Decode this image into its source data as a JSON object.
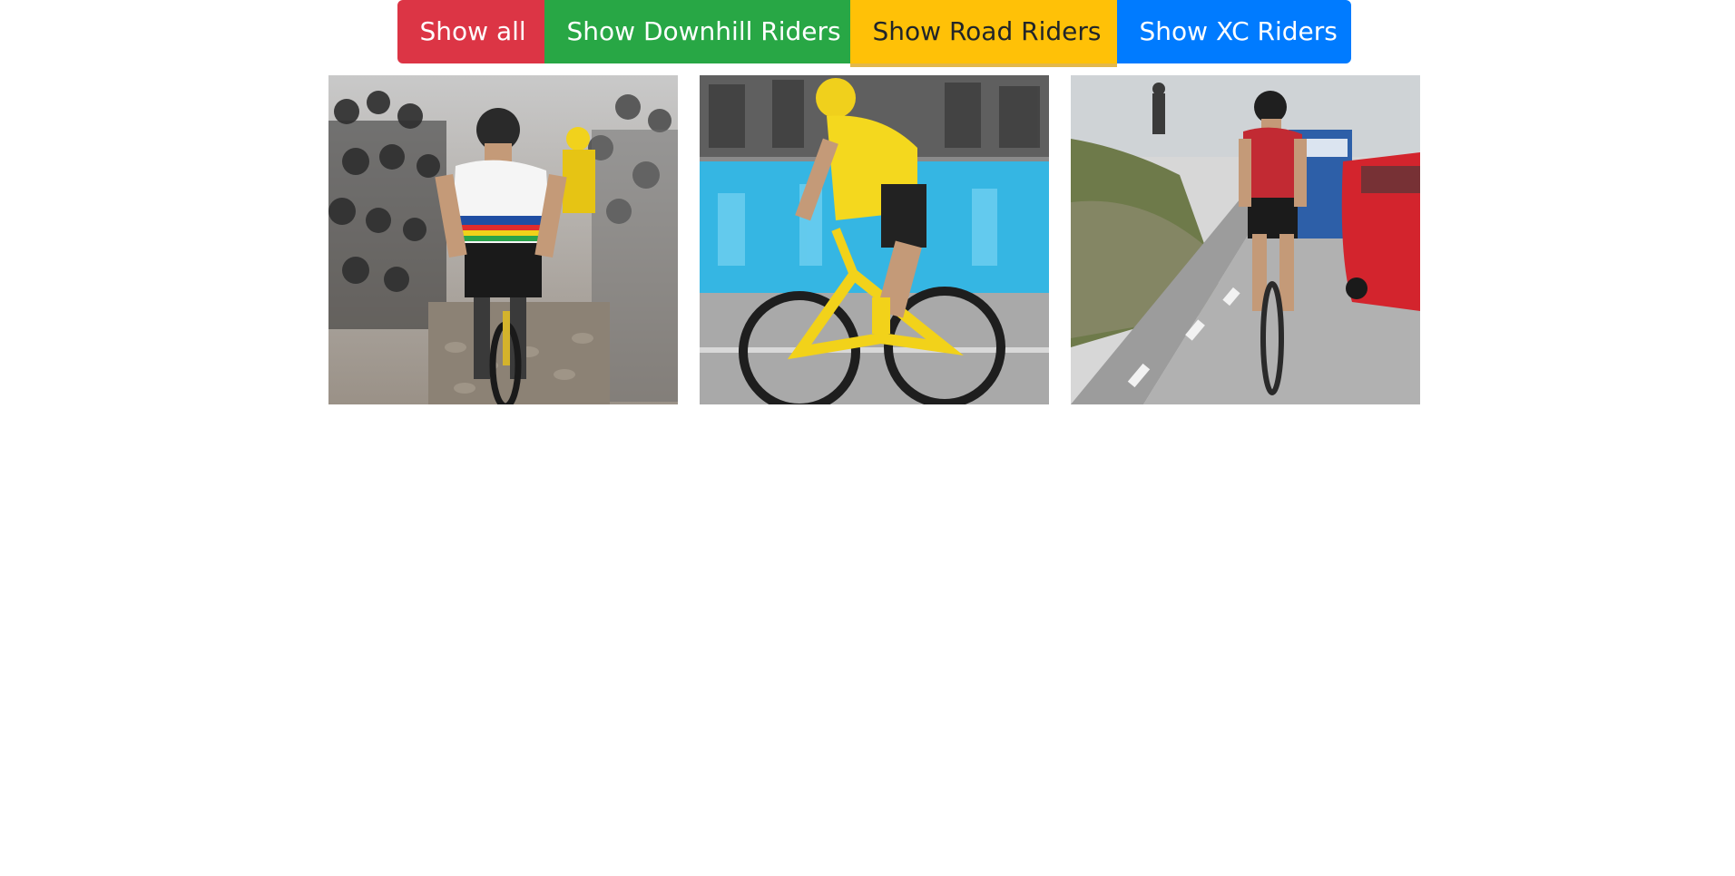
{
  "filters": {
    "show_all": "Show all",
    "downhill": "Show Downhill Riders",
    "road": "Show Road Riders",
    "xc": "Show XC Riders"
  },
  "colors": {
    "show_all": "#dc3545",
    "downhill": "#28a745",
    "road": "#ffc107",
    "xc": "#007bff"
  },
  "gallery": [
    {
      "icon": "cyclist-cobbles-photo"
    },
    {
      "icon": "cyclist-yellow-jersey-photo"
    },
    {
      "icon": "cyclist-mountain-road-photo"
    }
  ]
}
